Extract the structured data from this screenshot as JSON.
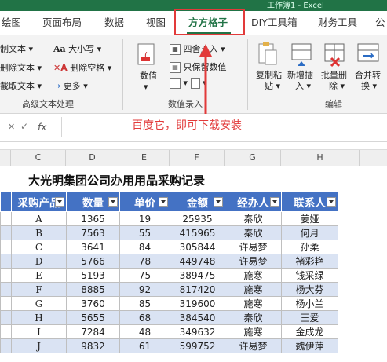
{
  "window": {
    "title": "工作簿1 - Excel"
  },
  "ribbon": {
    "tabs": [
      {
        "label": "绘图"
      },
      {
        "label": "页面布局"
      },
      {
        "label": "数据"
      },
      {
        "label": "视图"
      },
      {
        "label": "方方格子",
        "active": true
      },
      {
        "label": "DIY工具箱"
      },
      {
        "label": "财务工具"
      },
      {
        "label": "公"
      }
    ],
    "text_group": {
      "rows": [
        {
          "left": "制文本",
          "mid": "大小写"
        },
        {
          "left": "删除文本",
          "mid": "删除空格"
        },
        {
          "left": "截取文本",
          "mid": "更多"
        }
      ],
      "label": "高级文本处理"
    },
    "numeric_group": {
      "big_button": "数值",
      "items": [
        "四舍五入",
        "只保留数值"
      ],
      "label": "数值录入"
    },
    "edit_group": {
      "buttons": [
        {
          "line1": "复制粘",
          "line2": "贴"
        },
        {
          "line1": "新增插",
          "line2": "入"
        },
        {
          "line1": "批量删",
          "line2": "除"
        },
        {
          "line1": "合并转",
          "line2": "换"
        }
      ],
      "label": "编辑"
    }
  },
  "formula_bar": {
    "fx": "fx",
    "value": ""
  },
  "annotation": "百度它，即可下载安装",
  "columns": [
    "C",
    "D",
    "E",
    "F",
    "G",
    "H"
  ],
  "sheet": {
    "title": "大光明集团公司办用用品采购记录",
    "headers": [
      "采购产品",
      "数量",
      "单价",
      "金额",
      "经办人",
      "联系人"
    ],
    "rows": [
      [
        "A",
        "1365",
        "19",
        "25935",
        "秦欣",
        "姜娅"
      ],
      [
        "B",
        "7563",
        "55",
        "415965",
        "秦欣",
        "何月"
      ],
      [
        "C",
        "3641",
        "84",
        "305844",
        "许易梦",
        "孙柔"
      ],
      [
        "D",
        "5766",
        "78",
        "449748",
        "许易梦",
        "褚彩艳"
      ],
      [
        "E",
        "5193",
        "75",
        "389475",
        "施寒",
        "钱采绿"
      ],
      [
        "F",
        "8885",
        "92",
        "817420",
        "施寒",
        "杨大芬"
      ],
      [
        "G",
        "3760",
        "85",
        "319600",
        "施寒",
        "杨小兰"
      ],
      [
        "H",
        "5655",
        "68",
        "384540",
        "秦欣",
        "王爱"
      ],
      [
        "I",
        "7284",
        "48",
        "349632",
        "施寒",
        "金成龙"
      ],
      [
        "J",
        "9832",
        "61",
        "599752",
        "许易梦",
        "魏伊萍"
      ]
    ]
  },
  "colors": {
    "excel_green": "#217346",
    "table_header": "#4472c4",
    "table_band": "#dae3f3",
    "annotation_red": "#e23a3a"
  }
}
